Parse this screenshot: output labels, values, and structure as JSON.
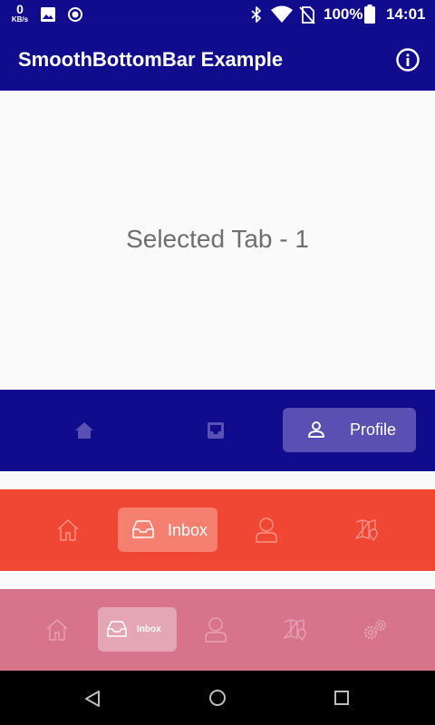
{
  "status_bar": {
    "speed_value": "0",
    "speed_unit": "KB/s",
    "battery": "100%",
    "time": "14:01"
  },
  "app_bar": {
    "title": "SmoothBottomBar Example"
  },
  "content": {
    "selected_text": "Selected Tab - 1"
  },
  "bar1": {
    "colors": {
      "background": "#110b8d",
      "active_pill": "#5a4fb2"
    },
    "items": [
      {
        "icon": "home-icon",
        "label": ""
      },
      {
        "icon": "inbox-icon",
        "label": ""
      },
      {
        "icon": "profile-icon",
        "label": "Profile"
      }
    ]
  },
  "bar2": {
    "colors": {
      "background": "#f04634",
      "active_pill": "#f6806f"
    },
    "items": [
      {
        "icon": "home-icon",
        "label": ""
      },
      {
        "icon": "inbox-icon",
        "label": "Inbox"
      },
      {
        "icon": "profile-icon",
        "label": ""
      },
      {
        "icon": "map-icon",
        "label": ""
      }
    ]
  },
  "bar3": {
    "colors": {
      "background": "#d7748c",
      "active_pill": "#e4a6b5"
    },
    "items": [
      {
        "icon": "home-icon",
        "label": ""
      },
      {
        "icon": "inbox-icon",
        "label": "Inbox"
      },
      {
        "icon": "profile-icon",
        "label": ""
      },
      {
        "icon": "map-icon",
        "label": ""
      },
      {
        "icon": "settings-icon",
        "label": ""
      }
    ]
  },
  "nav_bar": {
    "buttons": [
      "back-icon",
      "home-circle-icon",
      "recents-icon"
    ]
  }
}
